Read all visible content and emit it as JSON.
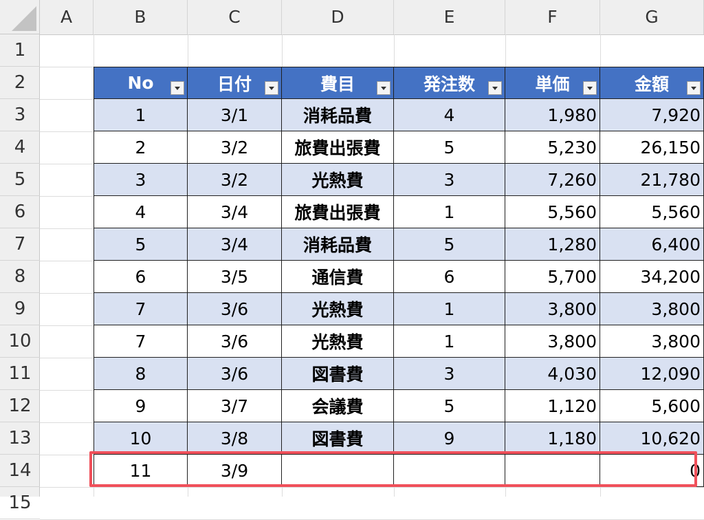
{
  "columns": [
    "A",
    "B",
    "C",
    "D",
    "E",
    "F",
    "G"
  ],
  "rows": [
    "1",
    "2",
    "3",
    "4",
    "5",
    "6",
    "7",
    "8",
    "9",
    "10",
    "11",
    "12",
    "13",
    "14",
    "15"
  ],
  "table": {
    "headers": [
      "No",
      "日付",
      "費目",
      "発注数",
      "単価",
      "金額"
    ],
    "data": [
      [
        "1",
        "3/1",
        "消耗品費",
        "4",
        "1,980",
        "7,920"
      ],
      [
        "2",
        "3/2",
        "旅費出張費",
        "5",
        "5,230",
        "26,150"
      ],
      [
        "3",
        "3/2",
        "光熱費",
        "3",
        "7,260",
        "21,780"
      ],
      [
        "4",
        "3/4",
        "旅費出張費",
        "1",
        "5,560",
        "5,560"
      ],
      [
        "5",
        "3/4",
        "消耗品費",
        "5",
        "1,280",
        "6,400"
      ],
      [
        "6",
        "3/5",
        "通信費",
        "6",
        "5,700",
        "34,200"
      ],
      [
        "7",
        "3/6",
        "光熱費",
        "1",
        "3,800",
        "3,800"
      ],
      [
        "7",
        "3/6",
        "光熱費",
        "1",
        "3,800",
        "3,800"
      ],
      [
        "8",
        "3/6",
        "図書費",
        "3",
        "4,030",
        "12,090"
      ],
      [
        "9",
        "3/7",
        "会議費",
        "5",
        "1,120",
        "5,600"
      ],
      [
        "10",
        "3/8",
        "図書費",
        "9",
        "1,180",
        "10,620"
      ],
      [
        "11",
        "3/9",
        "",
        "",
        "",
        "0"
      ]
    ]
  },
  "colors": {
    "header_bg": "#4472c4",
    "band_bg": "#d9e1f2",
    "highlight": "#f0505a"
  },
  "icons": [
    "filter-dropdown-icon"
  ]
}
